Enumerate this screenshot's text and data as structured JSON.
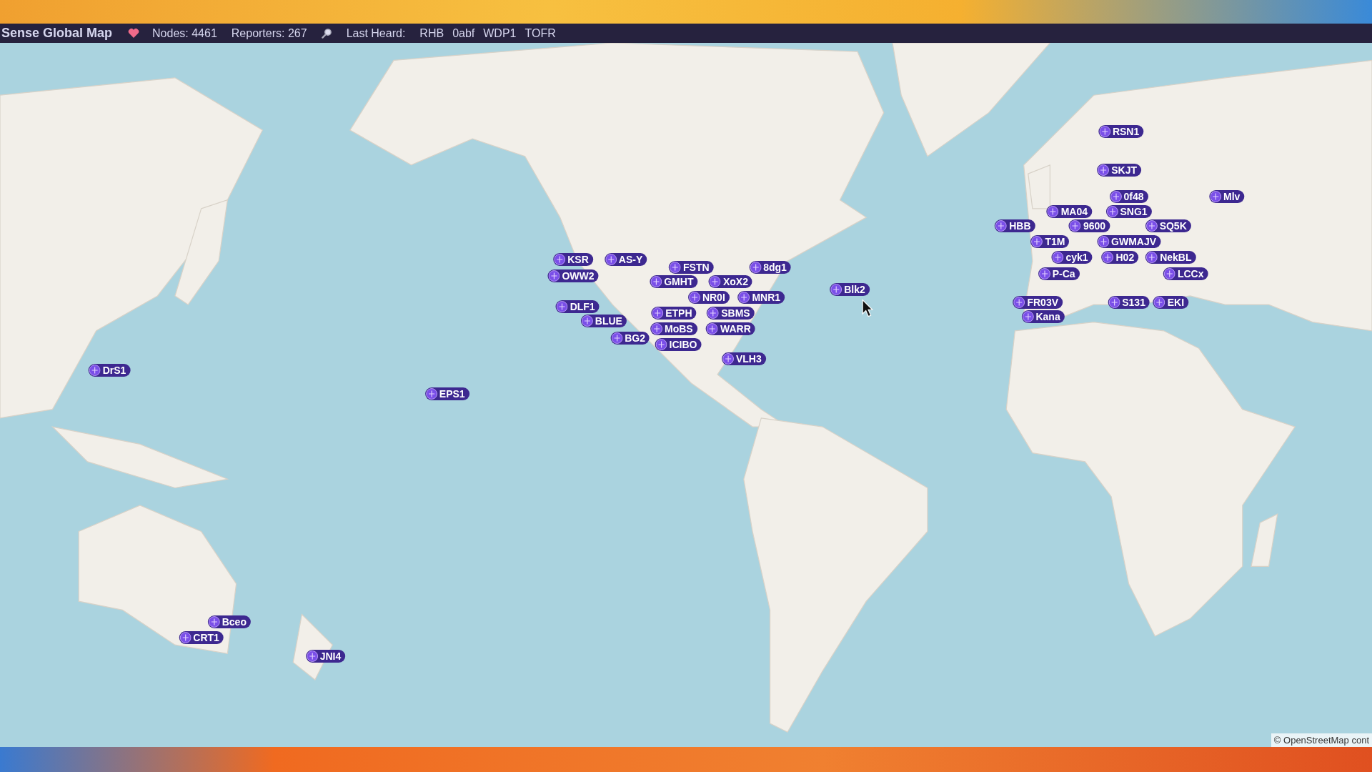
{
  "header": {
    "title": "Sense Global Map",
    "nodes": "Nodes: 4461",
    "reporters": "Reporters: 267",
    "last_heard_label": "Last Heard:",
    "last_heard": [
      "RHB",
      "0abf",
      "WDP1",
      "TOFR"
    ]
  },
  "map": {
    "markers": [
      {
        "label": "DrS1"
      },
      {
        "label": "EPS1"
      },
      {
        "label": "KSR"
      },
      {
        "label": "AS-Y"
      },
      {
        "label": "OWW2"
      },
      {
        "label": "DLF1"
      },
      {
        "label": "BLUE"
      },
      {
        "label": "BG2"
      },
      {
        "label": "FSTN"
      },
      {
        "label": "GMHT"
      },
      {
        "label": "XoX2"
      },
      {
        "label": "8dg1"
      },
      {
        "label": "MNR1"
      },
      {
        "label": "NR0I"
      },
      {
        "label": "ETPH"
      },
      {
        "label": "MoBS"
      },
      {
        "label": "SBMS"
      },
      {
        "label": "WARR"
      },
      {
        "label": "ICIBO"
      },
      {
        "label": "VLH3"
      },
      {
        "label": "Blk2"
      },
      {
        "label": "RSN1"
      },
      {
        "label": "SKJT"
      },
      {
        "label": "0f48"
      },
      {
        "label": "Mlv"
      },
      {
        "label": "MA04"
      },
      {
        "label": "SNG1"
      },
      {
        "label": "HBB"
      },
      {
        "label": "9600"
      },
      {
        "label": "SQ5K"
      },
      {
        "label": "T1M"
      },
      {
        "label": "GWMAJV"
      },
      {
        "label": "cyk1"
      },
      {
        "label": "H02"
      },
      {
        "label": "NekBL"
      },
      {
        "label": "P-Ca"
      },
      {
        "label": "LCCx"
      },
      {
        "label": "FR03V"
      },
      {
        "label": "S131"
      },
      {
        "label": "EKI"
      },
      {
        "label": "Kana"
      },
      {
        "label": "Bceo"
      },
      {
        "label": "CRT1"
      },
      {
        "label": "JNI4"
      }
    ],
    "attribution": "© OpenStreetMap cont"
  }
}
